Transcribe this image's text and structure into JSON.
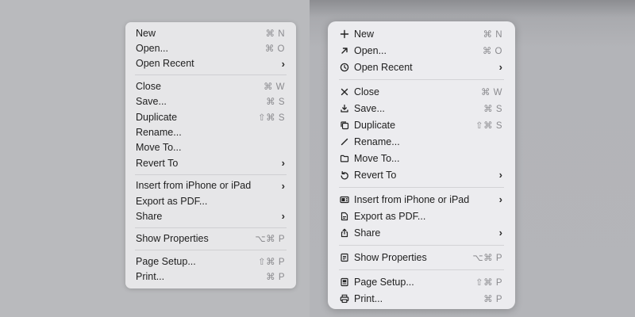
{
  "left_menu": {
    "items": [
      {
        "label": "New",
        "shortcut": "⌘ N"
      },
      {
        "label": "Open...",
        "shortcut": "⌘ O"
      },
      {
        "label": "Open Recent"
      },
      {
        "label": "Close",
        "shortcut": "⌘ W"
      },
      {
        "label": "Save...",
        "shortcut": "⌘ S"
      },
      {
        "label": "Duplicate",
        "shortcut": "⇧⌘ S"
      },
      {
        "label": "Rename..."
      },
      {
        "label": "Move To..."
      },
      {
        "label": "Revert To"
      },
      {
        "label": "Insert from iPhone or iPad"
      },
      {
        "label": "Export as PDF..."
      },
      {
        "label": "Share"
      },
      {
        "label": "Show Properties",
        "shortcut": "⌥⌘ P"
      },
      {
        "label": "Page Setup...",
        "shortcut": "⇧⌘ P"
      },
      {
        "label": "Print...",
        "shortcut": "⌘ P"
      }
    ],
    "submenu_arrow": "›"
  },
  "right_menu": {
    "items": [
      {
        "label": "New",
        "shortcut": "⌘ N",
        "icon": "plus-icon"
      },
      {
        "label": "Open...",
        "shortcut": "⌘ O",
        "icon": "arrow-up-right-icon"
      },
      {
        "label": "Open Recent",
        "icon": "clock-icon"
      },
      {
        "label": "Close",
        "shortcut": "⌘ W",
        "icon": "x-mark-icon"
      },
      {
        "label": "Save...",
        "shortcut": "⌘ S",
        "icon": "save-tray-icon"
      },
      {
        "label": "Duplicate",
        "shortcut": "⇧⌘ S",
        "icon": "duplicate-icon"
      },
      {
        "label": "Rename...",
        "icon": "pencil-icon"
      },
      {
        "label": "Move To...",
        "icon": "folder-icon"
      },
      {
        "label": "Revert To",
        "icon": "revert-arrow-icon"
      },
      {
        "label": "Insert from iPhone or iPad",
        "icon": "device-icon"
      },
      {
        "label": "Export as PDF...",
        "icon": "pdf-document-icon"
      },
      {
        "label": "Share",
        "icon": "share-icon"
      },
      {
        "label": "Show Properties",
        "shortcut": "⌥⌘ P",
        "icon": "properties-icon"
      },
      {
        "label": "Page Setup...",
        "shortcut": "⇧⌘ P",
        "icon": "page-setup-icon"
      },
      {
        "label": "Print...",
        "shortcut": "⌘ P",
        "icon": "printer-icon"
      }
    ],
    "submenu_arrow": "›"
  },
  "colors": {
    "background": "#b6b7bb",
    "menu_left": "#e6e6e8",
    "menu_right": "#ececef",
    "text": "#1e1e1e",
    "shortcut": "#8a8a8e"
  }
}
